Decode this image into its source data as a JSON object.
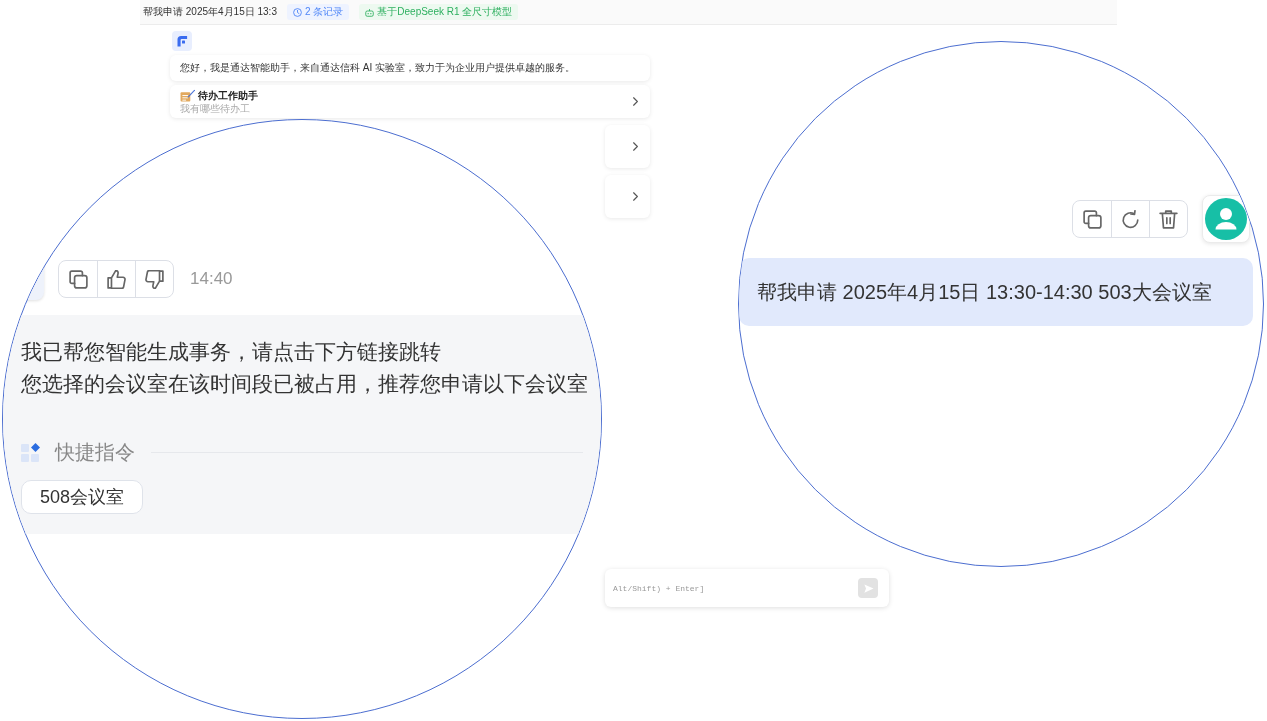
{
  "header": {
    "title": "帮我申请 2025年4月15日 13:3",
    "tags": [
      {
        "kind": "history",
        "label": "2 条记录"
      },
      {
        "kind": "model",
        "label": "基于DeepSeek R1 全尺寸模型"
      }
    ]
  },
  "welcome": {
    "greeting": "您好，我是通达智能助手，来自通达信科 AI 实验室，致力于为企业用户提供卓越的服务。",
    "cards": [
      {
        "kind": "shortcut",
        "title": "待办工作助手",
        "subtitle": "我有哪些待办工"
      },
      {
        "kind": "shortcut"
      },
      {
        "kind": "shortcut"
      }
    ]
  },
  "composer": {
    "placeholder": "Alt/Shift) + Enter]"
  },
  "magnified_reply": {
    "time": "14:40",
    "lines": [
      "我已帮您智能生成事务，请点击下方链接跳转",
      "您选择的会议室在该时间段已被占用，推荐您申请以下会议室"
    ],
    "quick_commands": {
      "title": "快捷指令",
      "items": [
        "508会议室"
      ]
    }
  },
  "magnified_request": {
    "message": "帮我申请 2025年4月15日 13:30-14:30 503大会议室"
  }
}
